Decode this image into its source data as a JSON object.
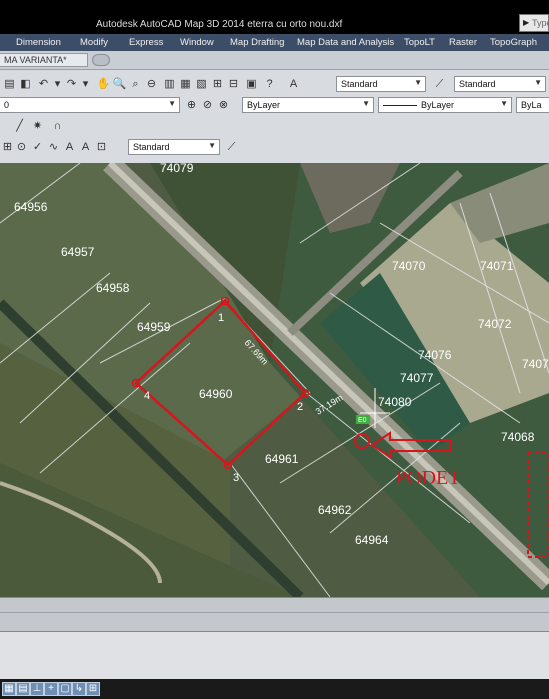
{
  "window": {
    "title": "Autodesk AutoCAD Map 3D 2014    eterra cu orto nou.dxf",
    "search_placeholder": "Type"
  },
  "menu": [
    "Dimension",
    "Modify",
    "Express",
    "Window",
    "Map Drafting",
    "Map Data and Analysis",
    "TopoLT",
    "Raster",
    "TopoGraph"
  ],
  "filetab": "MA VARIANTA*",
  "toolbar": {
    "text_style": "Standard",
    "dim_style": "Standard",
    "layer": "0",
    "color": "ByLayer",
    "linetype": "ByLayer",
    "lineweight": "ByLa",
    "multileader_style": "Standard"
  },
  "icons": {
    "undo": "undo-icon",
    "redo": "redo-icon",
    "pan": "pan-icon",
    "zoom": "zoom-icon",
    "properties": "properties-icon",
    "help": "help-icon",
    "text_style": "text-style-icon",
    "magnet": "magnet-icon"
  },
  "drawing": {
    "parcels": [
      "74079",
      "64956",
      "64957",
      "64958",
      "64959",
      "64960",
      "64961",
      "64962",
      "64964",
      "74070",
      "74071",
      "74072",
      "74076",
      "74077",
      "74080",
      "74068",
      "7407"
    ],
    "vertices": [
      "1",
      "2",
      "3",
      "4"
    ],
    "dimensions": [
      "67.69m",
      "37.19m"
    ],
    "annotation": "PODET",
    "marker": "E0"
  },
  "colors": {
    "accent_red": "#d8141c",
    "menubar": "#3c4d68",
    "toolbar_bg": "#d8dbe0"
  }
}
